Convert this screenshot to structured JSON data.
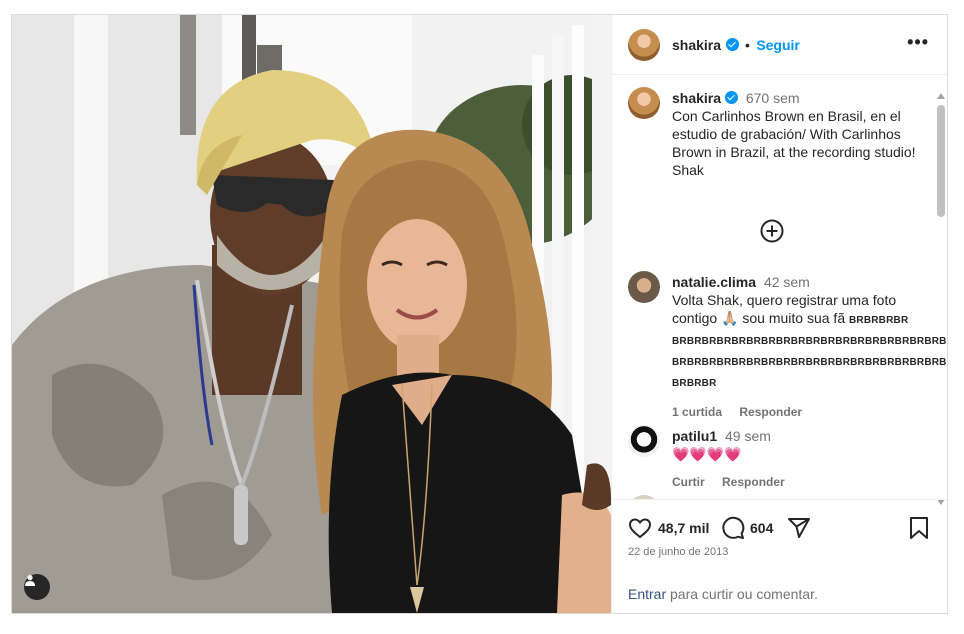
{
  "post": {
    "username": "shakira",
    "follow_label": "Seguir",
    "more_label": "•••",
    "caption": {
      "username": "shakira",
      "time": "670 sem",
      "text": "Con Carlinhos Brown en Brasil, en el estudio de grabación/ With Carlinhos Brown in Brazil, at the recording studio! Shak"
    },
    "load_more_icon": "plus-circle-icon",
    "comments": [
      {
        "username": "natalie.clima",
        "time": "42 sem",
        "text_line": "Volta Shak, quero registrar uma foto contigo",
        "emoji": "🙏🏼",
        "text_rest": "sou muito sua fã",
        "spam": "BRBRBRBR BRBRBRBRBRBRBRBRBRBRBRBRBRBRBRBRBRBRBRBR BRBRBRBRBRBRBRBRBRBRBRBRBRBRBRBRBRBRBRBRBRBR BRBRBR",
        "likes": "1 curtida",
        "reply": "Responder"
      },
      {
        "username": "patilu1",
        "time": "49 sem",
        "text": "💗💗💗💗",
        "likes": "Curtir",
        "reply": "Responder"
      }
    ],
    "likes_count": "48,7 mil",
    "comments_count": "604",
    "date": "22 de junho de 2013",
    "login_link": "Entrar",
    "login_rest": " para curtir ou comentar.",
    "colors": {
      "accent": "#0095f6",
      "muted": "#737373",
      "heart": "#ed4956"
    }
  }
}
